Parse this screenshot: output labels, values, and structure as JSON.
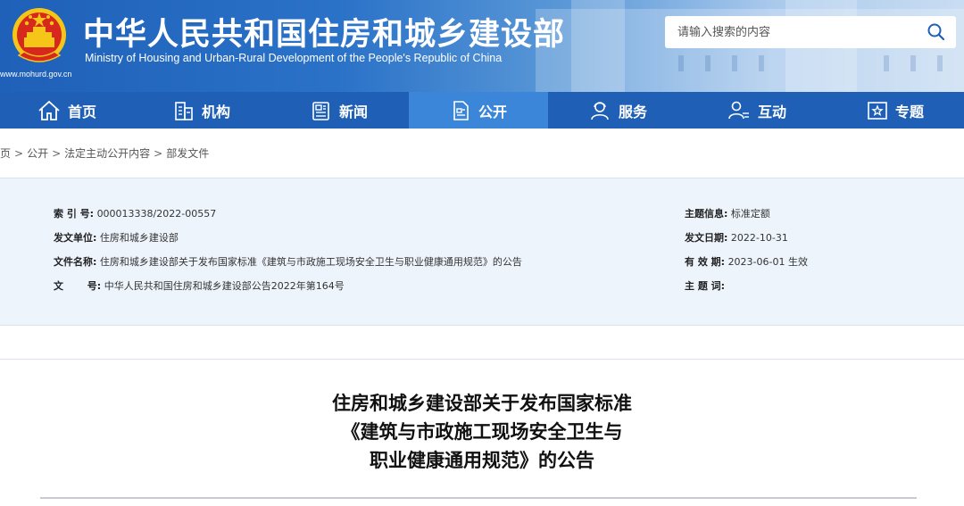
{
  "header": {
    "title": "中华人民共和国住房和城乡建设部",
    "subtitle": "Ministry of Housing and Urban-Rural Development of the People's Republic of China",
    "url": "www.mohurd.gov.cn",
    "search": {
      "placeholder": "请输入搜索的内容"
    }
  },
  "nav": {
    "items": [
      {
        "label": "首页",
        "icon": "home-icon"
      },
      {
        "label": "机构",
        "icon": "building-icon"
      },
      {
        "label": "新闻",
        "icon": "newspaper-icon"
      },
      {
        "label": "公开",
        "icon": "document-icon",
        "active": true
      },
      {
        "label": "服务",
        "icon": "service-icon"
      },
      {
        "label": "互动",
        "icon": "chat-person-icon"
      },
      {
        "label": "专题",
        "icon": "star-box-icon"
      }
    ]
  },
  "breadcrumb": [
    "首页",
    "公开",
    "法定主动公开内容",
    "部发文件"
  ],
  "info": {
    "index_label": "索 引 号:",
    "index_value": "000013338/2022-00557",
    "issuer_label": "发文单位:",
    "issuer_value": "住房和城乡建设部",
    "filename_label": "文件名称:",
    "filename_value": "住房和城乡建设部关于发布国家标准《建筑与市政施工现场安全卫生与职业健康通用规范》的公告",
    "docnum_label": "文       号:",
    "docnum_value": "中华人民共和国住房和城乡建设部公告2022年第164号",
    "topic_label": "主题信息:",
    "topic_value": "标准定额",
    "date_label": "发文日期:",
    "date_value": "2022-10-31",
    "validity_label": "有 效 期:",
    "validity_value": "2023-06-01 生效",
    "keywords_label": "主 题 词:",
    "keywords_value": ""
  },
  "article": {
    "title_lines": [
      "住房和城乡建设部关于发布国家标准",
      "《建筑与市政施工现场安全卫生与",
      "职业健康通用规范》的公告"
    ]
  },
  "colors": {
    "nav_bg": "#1f5fb5",
    "nav_active": "#3b86d8",
    "panel_bg": "#eef4fc"
  }
}
